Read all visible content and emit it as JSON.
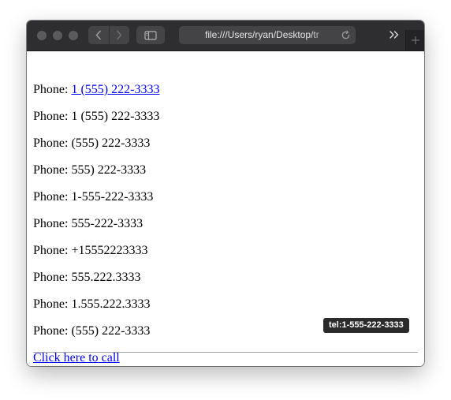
{
  "toolbar": {
    "url": "file:///Users/ryan/Desktop/tr"
  },
  "content": {
    "phone_prefix": "Phone: ",
    "linked_phone": "1 (555) 222-3333",
    "phone_lines": [
      "Phone: 1 (555) 222-3333",
      "Phone: (555) 222-3333",
      "Phone: 555) 222-3333",
      "Phone: 1-555-222-3333",
      "Phone: 555-222-3333",
      "Phone: +15552223333",
      "Phone: 555.222.3333",
      "Phone: 1.555.222.3333",
      "Phone: (555) 222-3333"
    ],
    "call_link": "Click here to call"
  },
  "status": {
    "hover_url": "tel:1-555-222-3333"
  },
  "colors": {
    "link": "#0000ee",
    "titlebar": "#2e2e30",
    "control": "#444447"
  }
}
